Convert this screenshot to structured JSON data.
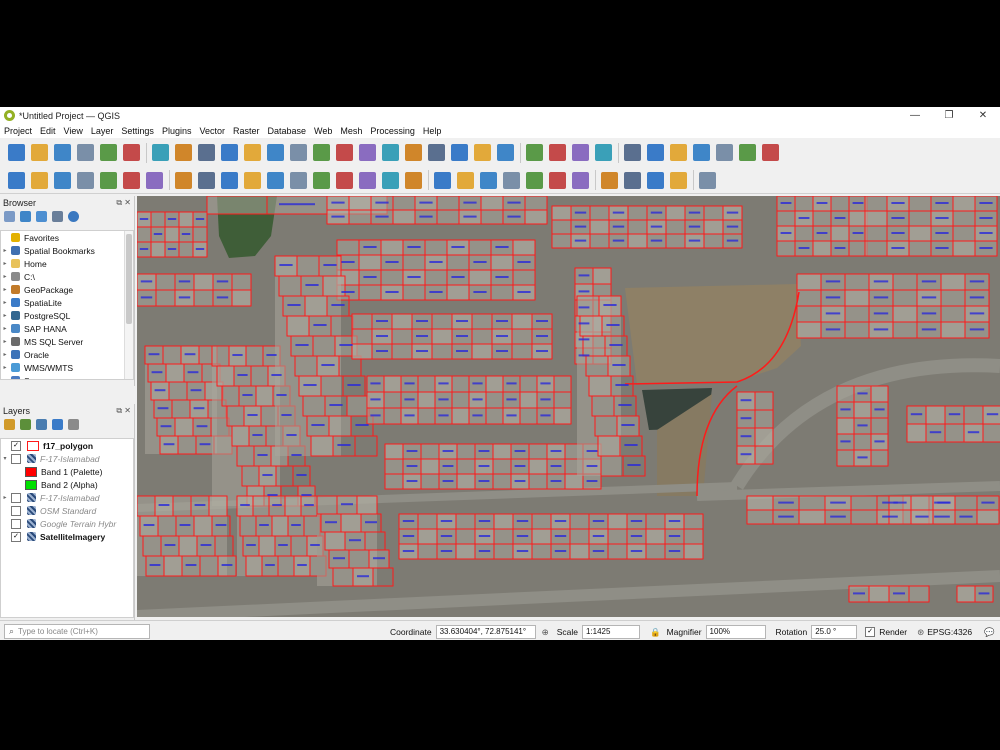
{
  "window": {
    "title": "*Untitled Project — QGIS",
    "controls": [
      "—",
      "❐",
      "✕"
    ]
  },
  "menu": [
    "Project",
    "Edit",
    "View",
    "Layer",
    "Settings",
    "Plugins",
    "Vector",
    "Raster",
    "Database",
    "Web",
    "Mesh",
    "Processing",
    "Help"
  ],
  "toolbars": {
    "row1_icons": [
      "new-project-icon",
      "open-project-icon",
      "save-project-icon",
      "save-as-icon",
      "print-layout-icon",
      "style-manager-icon",
      "sep",
      "pan-icon",
      "pan-to-selection-icon",
      "zoom-in-icon",
      "zoom-out-icon",
      "zoom-full-icon",
      "zoom-selection-icon",
      "zoom-layer-icon",
      "zoom-native-icon",
      "zoom-last-icon",
      "zoom-next-icon",
      "new-map-view-icon",
      "new-3d-view-icon",
      "temporal-icon",
      "decorations-icon",
      "bookmark-icon",
      "refresh-icon",
      "sep",
      "identify-icon",
      "select-icon",
      "select-dropdown-icon",
      "deselect-icon",
      "sep",
      "attribute-table-icon",
      "field-calc-icon",
      "processing-toolbox-icon",
      "statistics-icon",
      "measure-icon",
      "tips-icon",
      "settings-icon"
    ],
    "row2_icons": [
      "data-source-manager-icon",
      "new-geopackage-icon",
      "add-vector-icon",
      "digitize-icon",
      "add-wms-icon",
      "add-raster-icon",
      "add-mesh-icon",
      "sep",
      "edit-pencil-icon",
      "edit-toggle-icon",
      "save-edits-icon",
      "add-feature-icon",
      "vertex-tool-icon",
      "delete-icon",
      "cut-icon",
      "copy-icon",
      "paste-icon",
      "undo-icon",
      "redo-icon",
      "sep",
      "label-icon",
      "label-pin-icon",
      "label-highlight-icon",
      "label-move-icon",
      "label-rotate-icon",
      "label-change-icon",
      "label-show-icon",
      "sep",
      "plugin-globe-icon",
      "plugin-web-icon",
      "plugin-search-icon",
      "python-icon",
      "sep",
      "help-book-icon"
    ]
  },
  "browser": {
    "title": "Browser",
    "controls": "⧉ ✕",
    "items": [
      {
        "label": "Favorites",
        "icon": "star-icon",
        "color": "#e3b100"
      },
      {
        "label": "Spatial Bookmarks",
        "icon": "bookmark-icon",
        "color": "#3f6fb0"
      },
      {
        "label": "Home",
        "icon": "folder-icon",
        "color": "#e8c25a"
      },
      {
        "label": "C:\\",
        "icon": "drive-icon",
        "color": "#8a8a8a"
      },
      {
        "label": "GeoPackage",
        "icon": "geopackage-icon",
        "color": "#c27b2a"
      },
      {
        "label": "SpatiaLite",
        "icon": "spatialite-icon",
        "color": "#3a7bc8"
      },
      {
        "label": "PostgreSQL",
        "icon": "postgresql-icon",
        "color": "#336791"
      },
      {
        "label": "SAP HANA",
        "icon": "saphana-icon",
        "color": "#4a88c6"
      },
      {
        "label": "MS SQL Server",
        "icon": "mssql-icon",
        "color": "#6b6b6b"
      },
      {
        "label": "Oracle",
        "icon": "oracle-icon",
        "color": "#3d73b8"
      },
      {
        "label": "WMS/WMTS",
        "icon": "wms-icon",
        "color": "#4a9ad6"
      },
      {
        "label": "Scenes",
        "icon": "scenes-icon",
        "color": "#4a7ac0"
      }
    ]
  },
  "layers": {
    "title": "Layers",
    "controls": "⧉ ✕",
    "items": [
      {
        "label": "f17_polygon",
        "checked": true,
        "bold": true,
        "italic": false,
        "dim": false,
        "kind": "polygon",
        "indent": 0,
        "expander": ""
      },
      {
        "label": "F-17-Islamabad",
        "checked": false,
        "bold": false,
        "italic": true,
        "dim": true,
        "kind": "raster",
        "indent": 0,
        "expander": "▾"
      },
      {
        "label": "Band 1 (Palette)",
        "checked": null,
        "bold": false,
        "italic": false,
        "dim": false,
        "kind": "swatch-red",
        "indent": 1,
        "expander": ""
      },
      {
        "label": "Band 2 (Alpha)",
        "checked": null,
        "bold": false,
        "italic": false,
        "dim": false,
        "kind": "swatch-green",
        "indent": 1,
        "expander": ""
      },
      {
        "label": "F-17-Islamabad",
        "checked": false,
        "bold": false,
        "italic": true,
        "dim": true,
        "kind": "raster",
        "indent": 0,
        "expander": "▸"
      },
      {
        "label": "OSM Standard",
        "checked": false,
        "bold": false,
        "italic": true,
        "dim": true,
        "kind": "raster",
        "indent": 0,
        "expander": ""
      },
      {
        "label": "Google Terrain Hybr",
        "checked": false,
        "bold": false,
        "italic": true,
        "dim": true,
        "kind": "raster",
        "indent": 0,
        "expander": ""
      },
      {
        "label": "SatelliteImagery",
        "checked": true,
        "bold": true,
        "italic": false,
        "dim": false,
        "kind": "raster",
        "indent": 0,
        "expander": ""
      }
    ]
  },
  "status": {
    "locator_placeholder": "Type to locate (Ctrl+K)",
    "coordinate_label": "Coordinate",
    "coordinate_value": "33.630404°, 72.875141°",
    "scale_label": "Scale",
    "scale_value": "1:1425",
    "magnifier_label": "Magnifier",
    "magnifier_value": "100%",
    "rotation_label": "Rotation",
    "rotation_value": "25.0 °",
    "render_label": "Render",
    "render_checked": true,
    "crs_value": "EPSG:4326"
  },
  "colors": {
    "parcel_outline": "#ff1a1a",
    "parcel_label": "#2a2ad8",
    "imagery_road": "#8d8c84",
    "imagery_block": "#a9a59b"
  }
}
